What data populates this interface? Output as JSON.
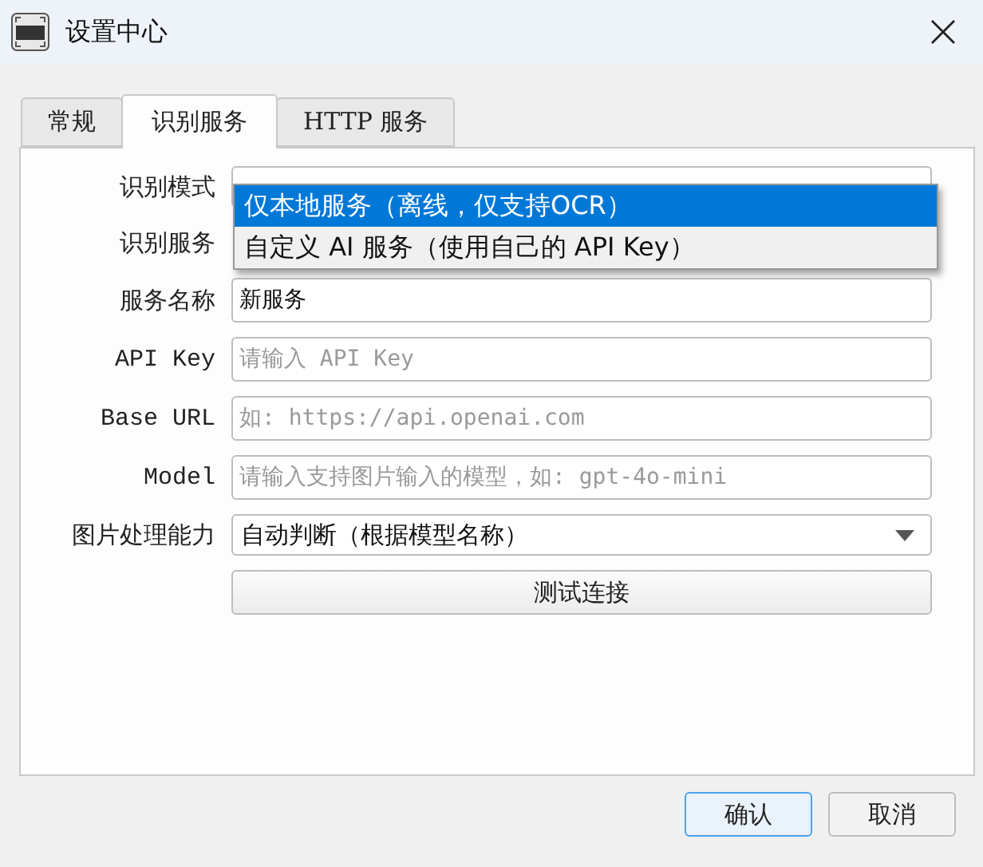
{
  "window": {
    "title": "设置中心"
  },
  "tabs": [
    {
      "label": "常规",
      "selected": false
    },
    {
      "label": "识别服务",
      "selected": true
    },
    {
      "label": "HTTP 服务",
      "selected": false
    }
  ],
  "form": [
    {
      "label": "识别模式",
      "kind": "select"
    },
    {
      "label": "识别服务",
      "kind": "none"
    },
    {
      "label": "服务名称",
      "kind": "text",
      "value": "新服务"
    },
    {
      "label": "API Key",
      "kind": "text",
      "placeholder": "请输入 API Key"
    },
    {
      "label": "Base URL",
      "kind": "text",
      "placeholder": "如: https://api.openai.com"
    },
    {
      "label": "Model",
      "kind": "text",
      "placeholder": "请输入支持图片输入的模型，如: gpt-4o-mini"
    },
    {
      "label": "图片处理能力",
      "kind": "select",
      "value": "自动判断（根据模型名称）"
    }
  ],
  "test_button": "测试连接",
  "dropdown": {
    "options": [
      {
        "label": "仅本地服务（离线，仅支持OCR）",
        "selected": true
      },
      {
        "label": "自定义 AI 服务（使用自己的 API Key）",
        "selected": false
      }
    ]
  },
  "buttons": [
    {
      "label": "确认",
      "default": true
    },
    {
      "label": "取消",
      "default": false
    }
  ]
}
